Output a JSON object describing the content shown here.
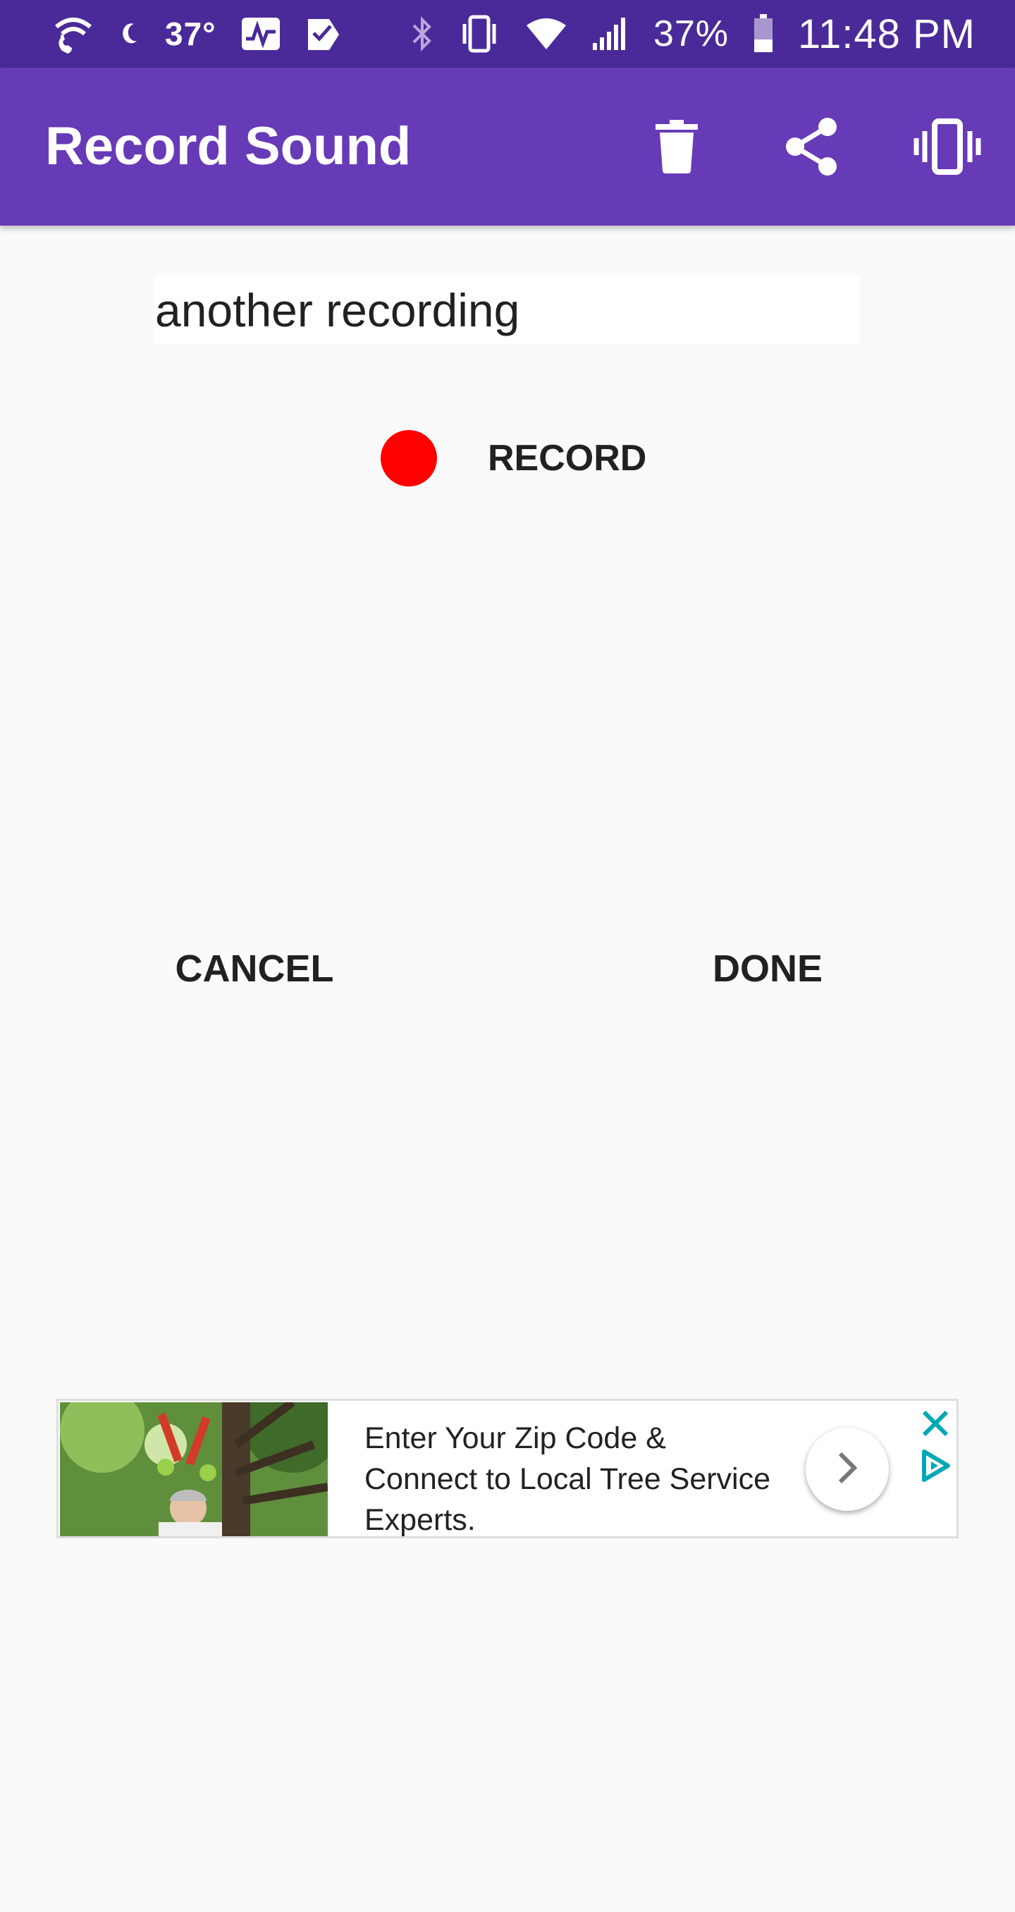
{
  "status_bar": {
    "temperature": "37°",
    "battery_percent": "37%",
    "time": "11:48 PM",
    "icons": [
      "wifi-call-icon",
      "moon-icon",
      "activity-icon",
      "task-check-icon",
      "bluetooth-icon",
      "vibrate-icon",
      "wifi-icon",
      "signal-icon",
      "battery-icon"
    ]
  },
  "app_bar": {
    "title": "Record Sound",
    "actions": [
      "delete-icon",
      "share-icon",
      "vibrate-icon"
    ]
  },
  "form": {
    "name_value": "another recording"
  },
  "record": {
    "label": "RECORD",
    "dot_color": "#ff0000"
  },
  "buttons": {
    "cancel": "CANCEL",
    "done": "DONE"
  },
  "ad": {
    "line1": "Enter Your Zip Code &",
    "line2": "Connect to Local Tree Service",
    "line3": "Experts.",
    "accent_color": "#00a8b5"
  },
  "colors": {
    "status_bar": "#4a2a98",
    "app_bar": "#673ab7",
    "background": "#fafafa"
  }
}
